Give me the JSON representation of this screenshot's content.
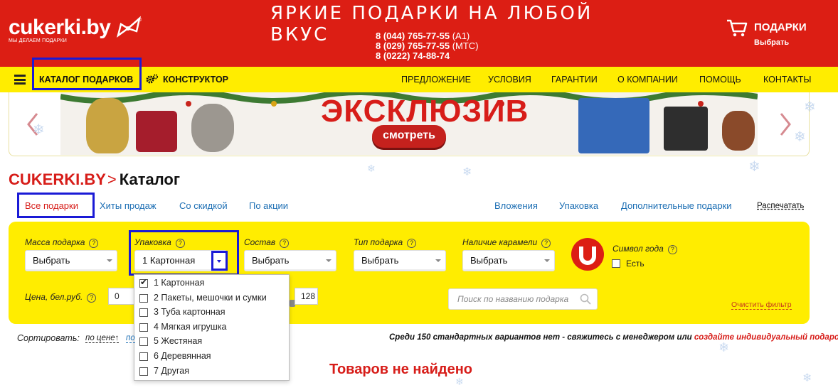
{
  "header": {
    "logo_text": "cukerki.by",
    "logo_trademark": "®",
    "logo_tagline": "МЫ ДЕЛАЕМ ПОДАРКИ",
    "slogan": "ЯРКИЕ ПОДАРКИ НА ЛЮБОЙ ВКУС",
    "phones": [
      {
        "number": "8 (044) 765-77-55",
        "operator": "(A1)"
      },
      {
        "number": "8 (029) 765-77-55",
        "operator": "(МТС)"
      },
      {
        "number": "8 (0222) 74-88-74",
        "operator": ""
      }
    ],
    "cart_title": "ПОДАРКИ",
    "cart_subtitle": "Выбрать"
  },
  "nav": {
    "catalog": "КАТАЛОГ ПОДАРКОВ",
    "constructor": "КОНСТРУКТОР",
    "right_items": [
      "ПРЕДЛОЖЕНИЕ",
      "УСЛОВИЯ",
      "ГАРАНТИИ",
      "О КОМПАНИИ",
      "ПОМОЩЬ",
      "КОНТАКТЫ"
    ]
  },
  "banner": {
    "title": "ЭКСКЛЮЗИВ",
    "button": "смотреть"
  },
  "breadcrumb": {
    "root": "CUKERKI.BY",
    "separator": ">",
    "current": "Каталог"
  },
  "tabs": {
    "left": [
      "Все подарки",
      "Хиты продаж",
      "Со скидкой",
      "По акции"
    ],
    "right": [
      "Вложения",
      "Упаковка",
      "Дополнительные подарки"
    ],
    "print": "Распечатать"
  },
  "filters": {
    "mass_label": "Масса подарка",
    "mass_value": "Выбрать",
    "pack_label": "Упаковка",
    "pack_value": "1 Картонная",
    "composition_label": "Состав",
    "composition_value": "Выбрать",
    "type_label": "Тип подарка",
    "type_value": "Выбрать",
    "caramel_label": "Наличие карамели",
    "caramel_value": "Выбрать",
    "symbol_label": "Символ года",
    "symbol_option": "Есть",
    "price_label": "Цена, бел.руб.",
    "price_min": "0",
    "price_max": "128",
    "search_placeholder": "Поиск по названию подарка",
    "clear": "Очистить фильтр",
    "help_glyph": "?"
  },
  "pack_options": [
    {
      "label": "1 Картонная",
      "checked": true
    },
    {
      "label": "2 Пакеты, мешочки и сумки",
      "checked": false
    },
    {
      "label": "3 Туба картонная",
      "checked": false
    },
    {
      "label": "4 Мягкая игрушка",
      "checked": false
    },
    {
      "label": "5 Жестяная",
      "checked": false
    },
    {
      "label": "6 Деревянная",
      "checked": false
    },
    {
      "label": "7 Другая",
      "checked": false
    }
  ],
  "sort": {
    "label": "Сортировать:",
    "by_price": "по цене↑",
    "by_other_partial": "по",
    "note_main": "Среди 150 стандартных вариантов нет - свяжитесь с менеджером или ",
    "note_link": "создайте индивидуальный подарок"
  },
  "results": {
    "empty_message": "Товаров не найдено"
  },
  "colors": {
    "brand_red": "#dc1e14",
    "brand_yellow": "#ffed00",
    "link_blue": "#1d6fb4",
    "highlight_blue": "#1a1ad6"
  }
}
